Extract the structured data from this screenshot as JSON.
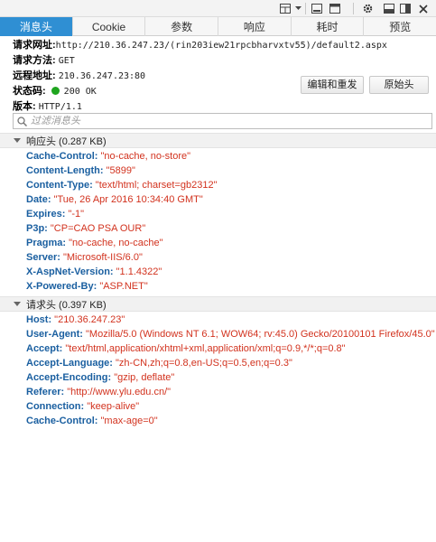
{
  "toolbar": {
    "icons": [
      "layout-icon",
      "chevron-down-icon",
      "minimize-icon",
      "window-icon",
      "gear-icon",
      "dock-icon",
      "close-icon"
    ]
  },
  "tabs": [
    {
      "label": "消息头",
      "active": true
    },
    {
      "label": "Cookie",
      "active": false
    },
    {
      "label": "参数",
      "active": false
    },
    {
      "label": "响应",
      "active": false
    },
    {
      "label": "耗时",
      "active": false
    },
    {
      "label": "预览",
      "active": false
    }
  ],
  "info": {
    "url_label": "请求网址:",
    "url_value": "http://210.36.247.23/(rin203iew21rpcbharvxtv55)/default2.aspx",
    "method_label": "请求方法:",
    "method_value": "GET",
    "remote_label": "远程地址:",
    "remote_value": "210.36.247.23:80",
    "status_label": "状态码:",
    "status_value": "200 OK",
    "status_color": "#1fa51f",
    "version_label": "版本:",
    "version_value": "HTTP/1.1"
  },
  "buttons": {
    "edit_resend": "编辑和重发",
    "raw_headers": "原始头"
  },
  "filter": {
    "placeholder": "过滤消息头"
  },
  "response_section": {
    "title": "响应头 (0.287 KB)",
    "headers": [
      {
        "name": "Cache-Control:",
        "value": "\"no-cache, no-store\""
      },
      {
        "name": "Content-Length:",
        "value": "\"5899\""
      },
      {
        "name": "Content-Type:",
        "value": "\"text/html; charset=gb2312\""
      },
      {
        "name": "Date:",
        "value": "\"Tue, 26 Apr 2016 10:34:40 GMT\""
      },
      {
        "name": "Expires:",
        "value": "\"-1\""
      },
      {
        "name": "P3p:",
        "value": "\"CP=CAO PSA OUR\""
      },
      {
        "name": "Pragma:",
        "value": "\"no-cache, no-cache\""
      },
      {
        "name": "Server:",
        "value": "\"Microsoft-IIS/6.0\""
      },
      {
        "name": "X-AspNet-Version:",
        "value": "\"1.1.4322\""
      },
      {
        "name": "X-Powered-By:",
        "value": "\"ASP.NET\""
      }
    ]
  },
  "request_section": {
    "title": "请求头 (0.397 KB)",
    "headers": [
      {
        "name": "Host:",
        "value": "\"210.36.247.23\""
      },
      {
        "name": "User-Agent:",
        "value": "\"Mozilla/5.0 (Windows NT 6.1; WOW64; rv:45.0) Gecko/20100101 Firefox/45.0\""
      },
      {
        "name": "Accept:",
        "value": "\"text/html,application/xhtml+xml,application/xml;q=0.9,*/*;q=0.8\""
      },
      {
        "name": "Accept-Language:",
        "value": "\"zh-CN,zh;q=0.8,en-US;q=0.5,en;q=0.3\""
      },
      {
        "name": "Accept-Encoding:",
        "value": "\"gzip, deflate\""
      },
      {
        "name": "Referer:",
        "value": "\"http://www.ylu.edu.cn/\""
      },
      {
        "name": "Connection:",
        "value": "\"keep-alive\""
      },
      {
        "name": "Cache-Control:",
        "value": "\"max-age=0\""
      }
    ]
  },
  "colors": {
    "accent": "#2f8fd3",
    "header_name": "#1a5fa0",
    "header_value": "#d2321e"
  }
}
